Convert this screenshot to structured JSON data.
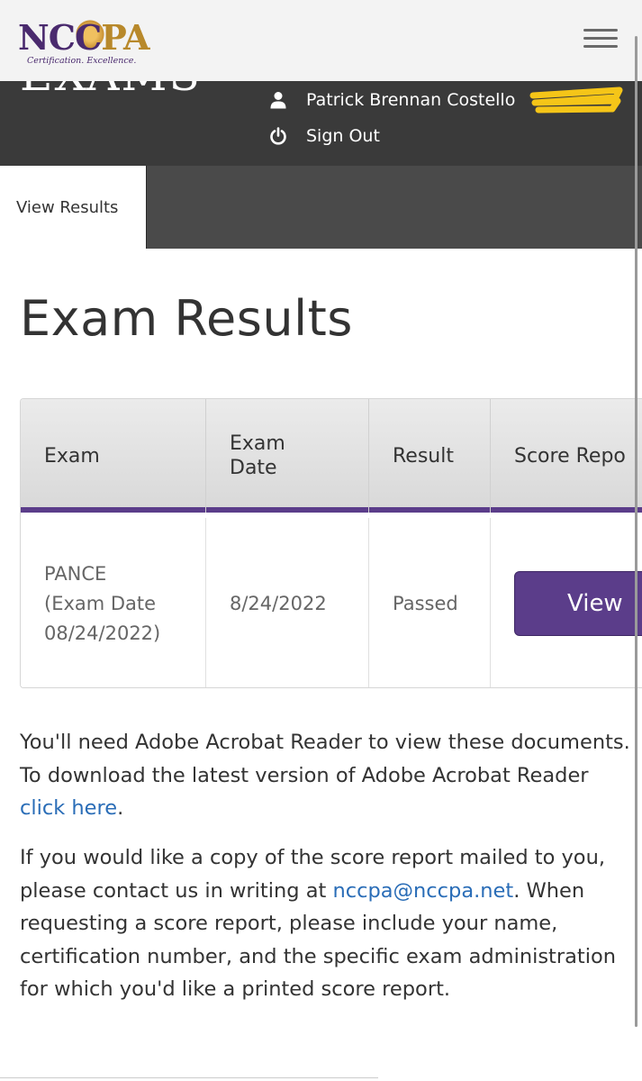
{
  "header": {
    "logo": {
      "letters_left": "NC",
      "letter_c": "C",
      "letters_right": "PA",
      "tagline": "Certification.   Excellence."
    },
    "menu_icon": "hamburger-icon"
  },
  "user_band": {
    "cut_title": "EXAMS",
    "user_name": "Patrick Brennan Costello",
    "user_icon": "user-icon",
    "sign_out_label": "Sign Out",
    "sign_out_icon": "power-icon",
    "redaction_color": "#f5c518"
  },
  "tabs": {
    "active_label": "View Results"
  },
  "page_title": "Exam Results",
  "table": {
    "headers": {
      "exam": "Exam",
      "exam_date_line1": "Exam",
      "exam_date_line2": "Date",
      "result": "Result",
      "score_report": "Score Repo"
    },
    "rows": [
      {
        "exam_line1": "PANCE",
        "exam_line2": "(Exam Date",
        "exam_line3": "08/24/2022)",
        "date": "8/24/2022",
        "result": "Passed",
        "action": "View"
      }
    ]
  },
  "paragraph1": {
    "text_before": "You'll need Adobe Acrobat Reader to view these documents. To download the latest version of Adobe Acrobat Reader ",
    "link": "click here",
    "text_after": "."
  },
  "paragraph2": {
    "text_before": "If you would like a copy of the score report mailed to you, please contact us in writing at ",
    "link": "nccpa@nccpa.net",
    "text_after": ". When requesting a score report, please include your name, certification number, and the specific exam administration for which you'd like a printed score report."
  },
  "colors": {
    "brand_purple": "#5b3d8a",
    "brand_gold": "#b8892b",
    "dark_band": "#3a3a3a",
    "link": "#2a6db7"
  }
}
